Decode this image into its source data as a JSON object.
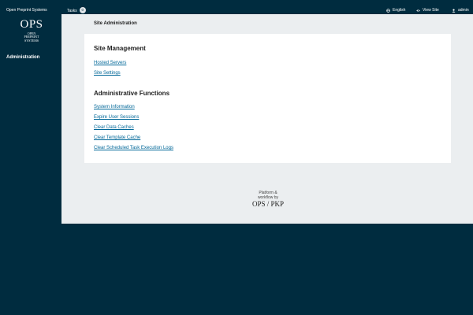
{
  "topbar": {
    "site_name": "Open Preprint Systems",
    "tasks_label": "Tasks",
    "tasks_count": "0",
    "language": "English",
    "view_site": "View Site",
    "user": "admin"
  },
  "sidebar": {
    "logo_big": "OPS",
    "logo_small_1": "OPEN",
    "logo_small_2": "PREPRINT",
    "logo_small_3": "SYSTEMS",
    "items": [
      {
        "label": "Administration"
      }
    ]
  },
  "main": {
    "title": "Site Administration",
    "site_management": {
      "title": "Site Management",
      "links": [
        "Hosted Servers",
        "Site Settings"
      ]
    },
    "admin_functions": {
      "title": "Administrative Functions",
      "links": [
        "System Information",
        "Expire User Sessions",
        "Clear Data Caches",
        "Clear Template Cache",
        "Clear Scheduled Task Execution Logs"
      ]
    },
    "footer": {
      "line1": "Platform &",
      "line2": "workflow by",
      "brand": "OPS / PKP"
    }
  },
  "colors": {
    "background": "#002c3f",
    "content_bg": "#ebeef0",
    "panel_bg": "#ffffff",
    "link": "#006798"
  }
}
